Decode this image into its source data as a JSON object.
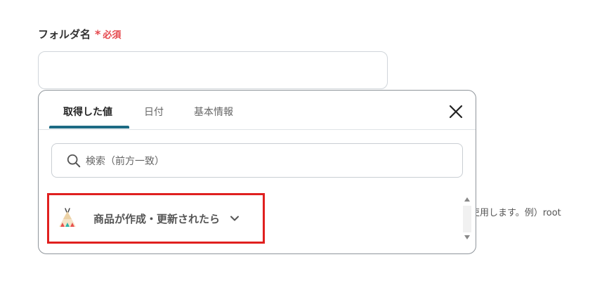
{
  "field": {
    "label": "フォルダ名",
    "asterisk": "*",
    "required": "必須",
    "value": ""
  },
  "background_hint": "吏用します。例）root",
  "popup": {
    "tabs": [
      {
        "label": "取得した値",
        "active": true
      },
      {
        "label": "日付",
        "active": false
      },
      {
        "label": "基本情報",
        "active": false
      }
    ],
    "search": {
      "placeholder": "検索（前方一致）",
      "icon": "search-icon"
    },
    "items": [
      {
        "label": "商品が作成・更新されたら",
        "icon": "teepee-app-icon",
        "expand_icon": "chevron-down-icon"
      }
    ]
  },
  "colors": {
    "required": "#e5484d",
    "tab_indicator": "#1d6b84",
    "highlight_border": "#e0201f"
  }
}
